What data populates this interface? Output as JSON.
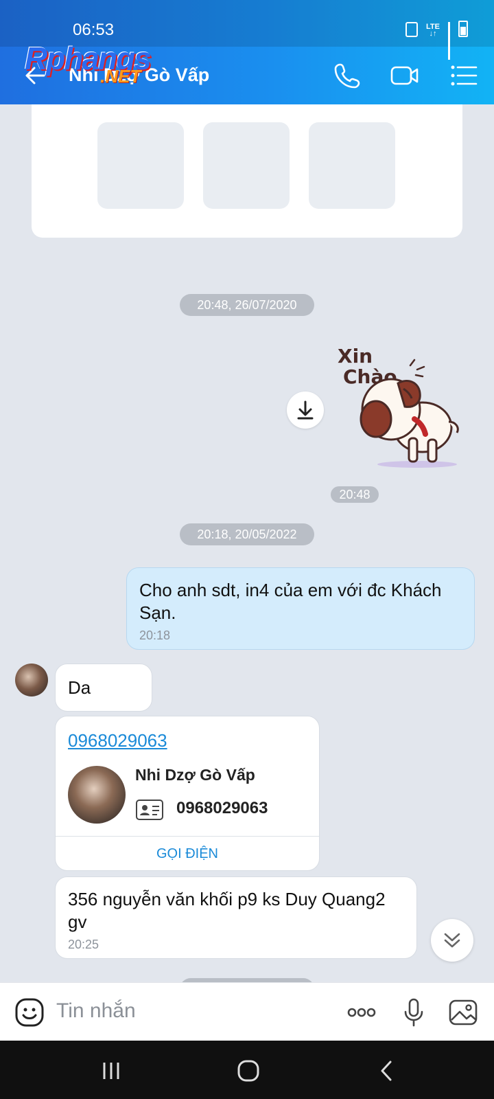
{
  "status_bar": {
    "time": "06:53",
    "network": "LTE"
  },
  "app_bar": {
    "title": "Nhi Dzợ Gò Vấp",
    "watermark_main": "Rphangs",
    "watermark_sub": ".NET"
  },
  "chat": {
    "timestamp_1": "20:48, 26/07/2020",
    "sticker": {
      "time": "20:48",
      "label_line1": "Xin",
      "label_line2": "Chào"
    },
    "timestamp_2": "20:18, 20/05/2022",
    "outgoing_message": {
      "text": "Cho anh sdt, in4 của em với đc Khách Sạn.",
      "time": "20:18"
    },
    "incoming_message_1": {
      "text": "Da"
    },
    "contact_card": {
      "phone_link": "0968029063",
      "name": "Nhi Dzợ Gò Vấp",
      "number": "0968029063",
      "call_label": "GỌI ĐIỆN"
    },
    "incoming_message_2": {
      "text": "356 nguyễn văn khối p9 ks Duy Quang2 gv",
      "time": "20:25"
    }
  },
  "input_bar": {
    "placeholder": "Tin nhắn"
  },
  "colors": {
    "header_start": "#1f6fe0",
    "header_end": "#12b3f5",
    "outgoing_bubble": "#d4ecfc",
    "link": "#1a8ad8"
  }
}
